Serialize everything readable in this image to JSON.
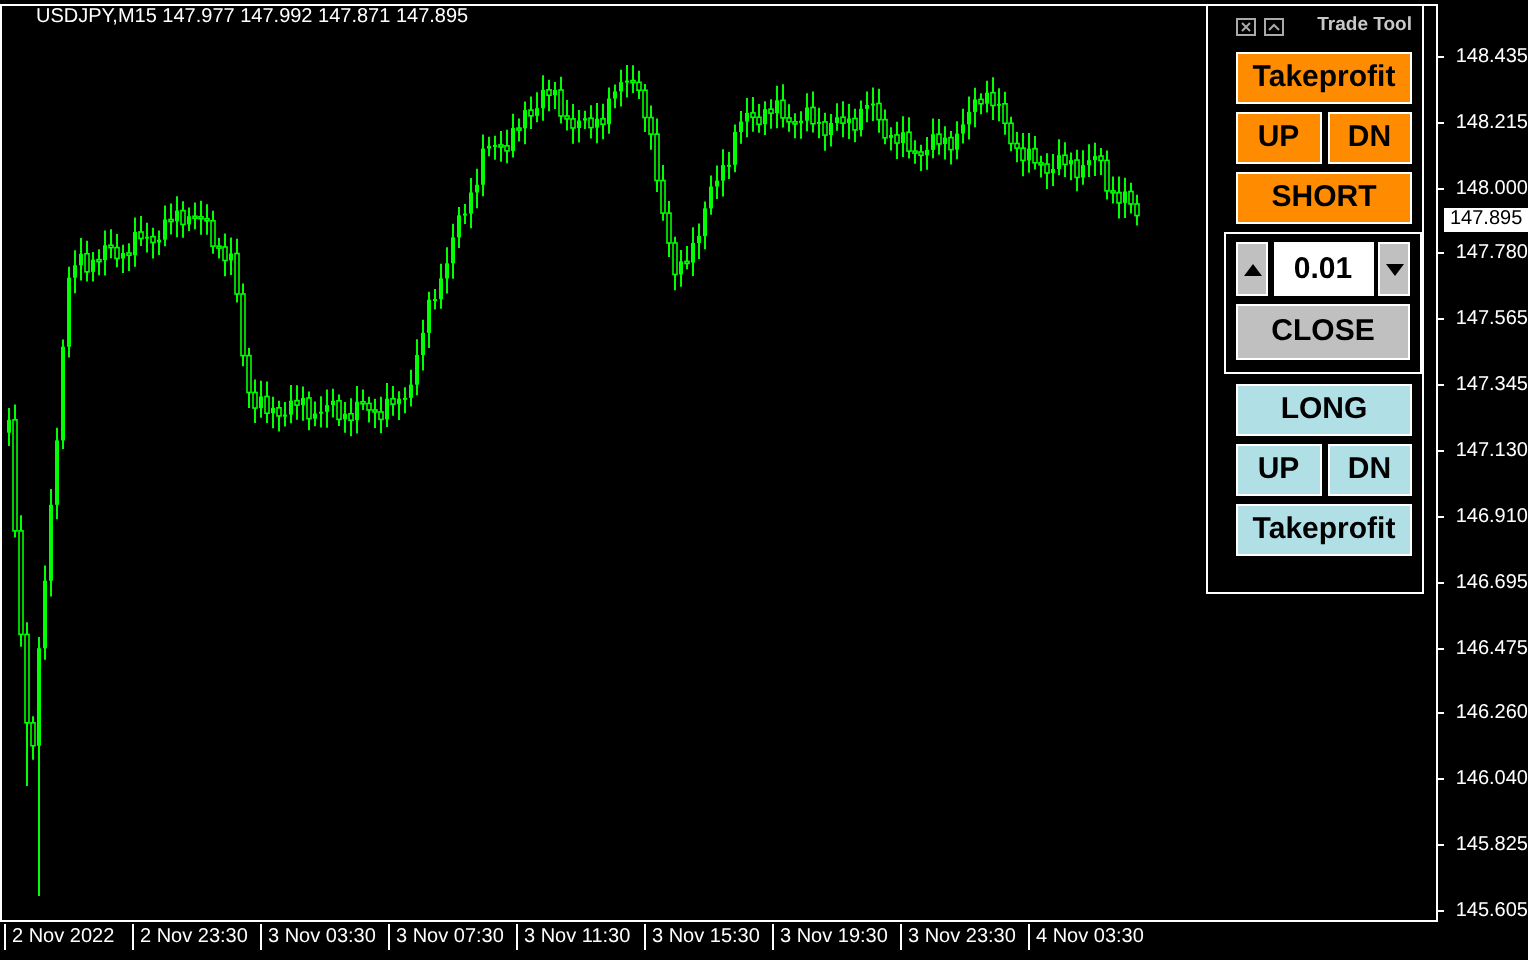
{
  "chart": {
    "info": "USDJPY,M15  147.977 147.992 147.871 147.895"
  },
  "price_axis": [
    "148.435",
    "148.215",
    "148.000",
    "147.780",
    "147.565",
    "147.345",
    "147.130",
    "146.910",
    "146.695",
    "146.475",
    "146.260",
    "146.040",
    "145.825",
    "145.605"
  ],
  "current_price": "147.895",
  "time_axis": [
    "2 Nov 2022",
    "2 Nov 23:30",
    "3 Nov 03:30",
    "3 Nov 07:30",
    "3 Nov 11:30",
    "3 Nov 15:30",
    "3 Nov 19:30",
    "3 Nov 23:30",
    "4 Nov 03:30"
  ],
  "trade_panel": {
    "title": "Trade Tool",
    "sections": [
      {
        "kind": "sell",
        "rows": [
          [
            "Takeprofit"
          ],
          [
            "UP",
            "DN"
          ],
          [
            "SHORT"
          ]
        ]
      },
      {
        "kind": "lot",
        "value": "0.01",
        "button": "CLOSE"
      },
      {
        "kind": "buy",
        "rows": [
          [
            "LONG"
          ],
          [
            "UP",
            "DN"
          ],
          [
            "Takeprofit"
          ]
        ]
      }
    ]
  }
}
